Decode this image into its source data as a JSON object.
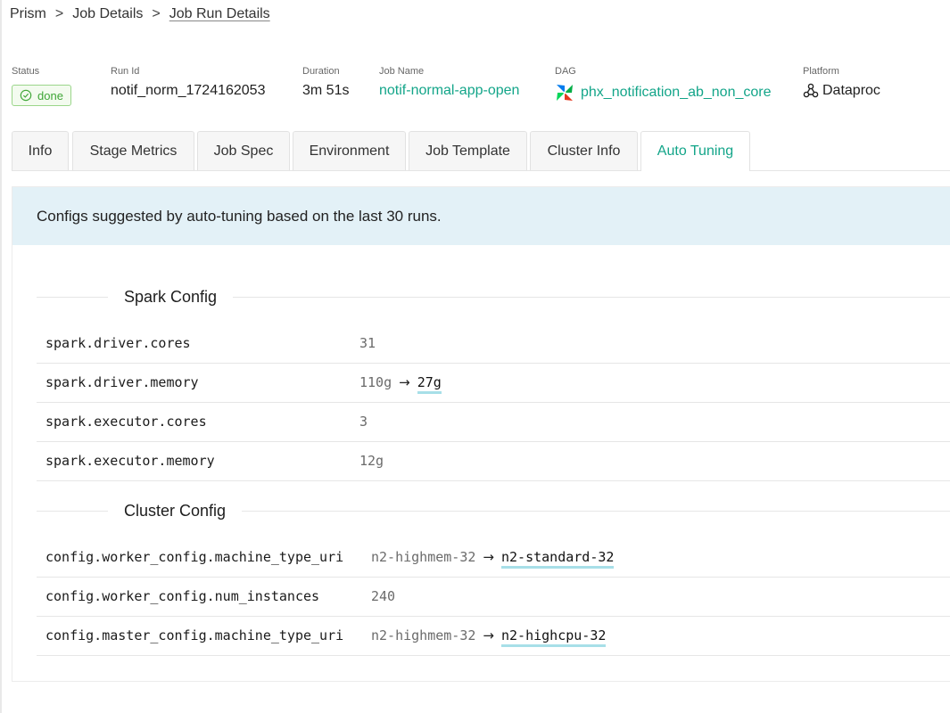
{
  "breadcrumb": {
    "items": [
      "Prism",
      "Job Details",
      "Job Run Details"
    ],
    "separator": ">"
  },
  "meta": {
    "status": {
      "label": "Status",
      "value": "done"
    },
    "run_id": {
      "label": "Run Id",
      "value": "notif_norm_1724162053"
    },
    "duration": {
      "label": "Duration",
      "value": "3m 51s"
    },
    "job_name": {
      "label": "Job Name",
      "value": "notif-normal-app-open"
    },
    "dag": {
      "label": "DAG",
      "value": "phx_notification_ab_non_core",
      "icon": "airflow-pinwheel-icon"
    },
    "platform": {
      "label": "Platform",
      "value": "Dataproc",
      "icon": "dataproc-icon"
    }
  },
  "tabs": [
    {
      "label": "Info"
    },
    {
      "label": "Stage Metrics"
    },
    {
      "label": "Job Spec"
    },
    {
      "label": "Environment"
    },
    {
      "label": "Job Template"
    },
    {
      "label": "Cluster Info"
    },
    {
      "label": "Auto Tuning",
      "active": true
    }
  ],
  "banner": "Configs suggested by auto-tuning based on the last 30 runs.",
  "sections": {
    "spark": {
      "title": "Spark Config",
      "rows": [
        {
          "key": "spark.driver.cores",
          "value": "31"
        },
        {
          "key": "spark.driver.memory",
          "old": "110g",
          "arrow": "→",
          "new": "27g"
        },
        {
          "key": "spark.executor.cores",
          "value": "3"
        },
        {
          "key": "spark.executor.memory",
          "value": "12g"
        }
      ]
    },
    "cluster": {
      "title": "Cluster Config",
      "rows": [
        {
          "key": "config.worker_config.machine_type_uri",
          "old": "n2-highmem-32",
          "arrow": "→",
          "new": "n2-standard-32"
        },
        {
          "key": "config.worker_config.num_instances",
          "value": "240"
        },
        {
          "key": "config.master_config.machine_type_uri",
          "old": "n2-highmem-32",
          "arrow": "→",
          "new": "n2-highcpu-32"
        }
      ]
    }
  },
  "colors": {
    "accent": "#13a589",
    "status_green": "#3fa637",
    "banner_bg": "#e3f1f7",
    "highlight_underline": "#a7dfe8"
  }
}
